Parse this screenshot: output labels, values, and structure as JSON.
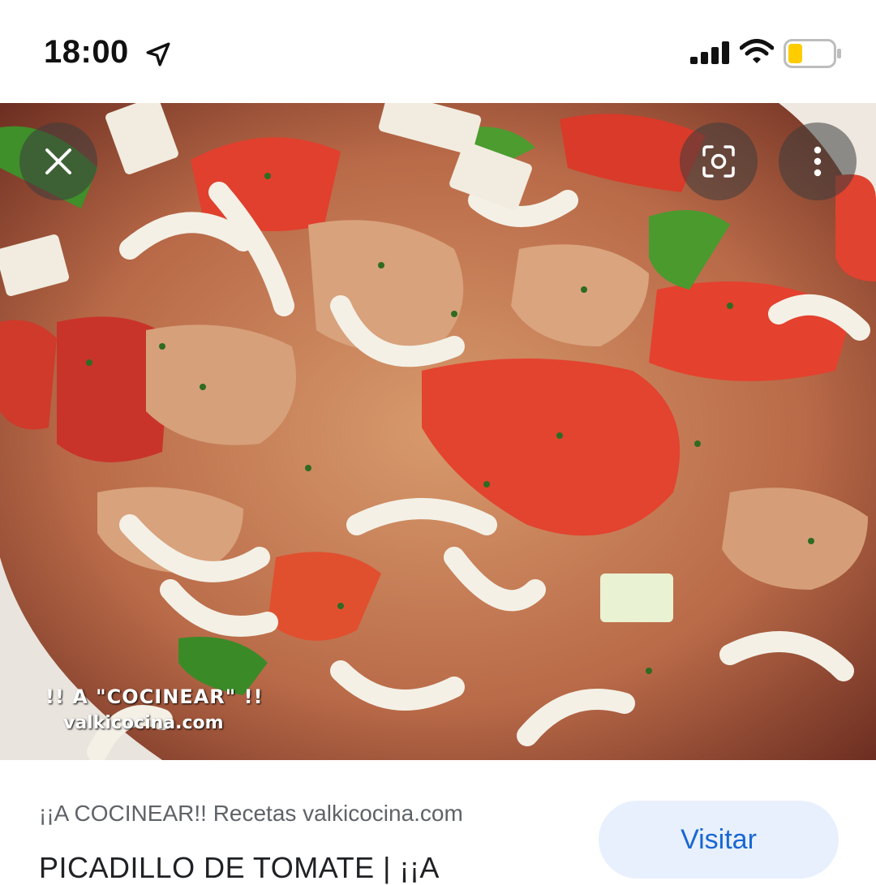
{
  "status_bar": {
    "time": "18:00",
    "icons": [
      "location-arrow-icon",
      "cellular-signal-icon",
      "wifi-icon",
      "battery-low-icon"
    ],
    "battery_color": "#ffcc00"
  },
  "image_viewer": {
    "buttons": [
      "close-icon",
      "lens-icon",
      "more-vert-icon"
    ],
    "watermark_line1": "!! A \"COCINEAR\" !!",
    "watermark_line2": "valkicocina.com"
  },
  "result": {
    "source": "¡¡A COCINEAR!! Recetas valkicocina.com",
    "title": "PICADILLO DE TOMATE | ¡¡A",
    "visit_label": "Visitar",
    "accent_color": "#1967d2",
    "button_bg": "#e8f0fe"
  }
}
